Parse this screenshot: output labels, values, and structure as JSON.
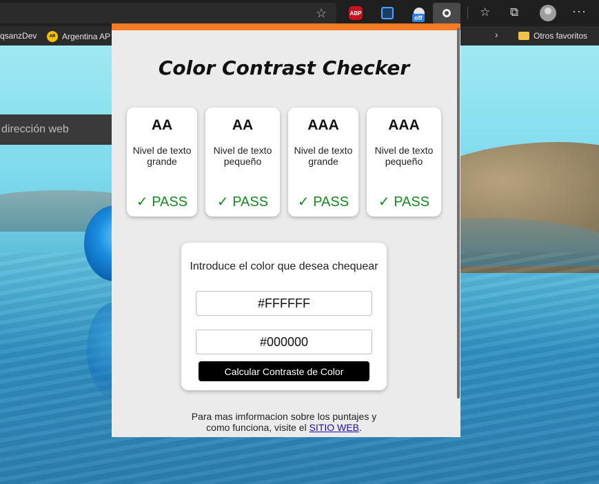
{
  "browser": {
    "bookmarks": [
      {
        "label": "qsanzDev"
      },
      {
        "label": "Argentina AP"
      },
      {
        "label": "Otros favoritos"
      }
    ],
    "address_placeholder": "dirección web",
    "extensions": {
      "abp_label": "ABP",
      "off_badge": "off"
    },
    "icons": [
      "star-icon",
      "abp-icon",
      "blue-extension-icon",
      "off-extension-icon",
      "active-extension-icon",
      "favorites-icon",
      "collections-icon",
      "profile-avatar",
      "more-icon",
      "chevron-right-icon",
      "folder-icon"
    ],
    "theme": {
      "toolbar": "#1f1f1f",
      "popup_accent": "#f57c25",
      "pass": "#148a1f"
    }
  },
  "popup": {
    "title": "Color Contrast Checker",
    "cards": [
      {
        "level": "AA",
        "desc": "Nivel de texto grande",
        "status": "✓ PASS"
      },
      {
        "level": "AA",
        "desc": "Nivel de texto pequeño",
        "status": "✓ PASS"
      },
      {
        "level": "AAA",
        "desc": "Nivel de texto grande",
        "status": "✓ PASS"
      },
      {
        "level": "AAA",
        "desc": "Nivel de texto pequeño",
        "status": "✓ PASS"
      }
    ],
    "form": {
      "prompt": "Introduce el color que desea chequear",
      "color1": "#FFFFFF",
      "color2": "#000000",
      "button": "Calcular Contraste de Color"
    },
    "footer": {
      "text1": "Para mas imformacion sobre los puntajes y",
      "text2": "como funciona, visite el",
      "link": "SITIO WEB",
      "end": "."
    }
  }
}
